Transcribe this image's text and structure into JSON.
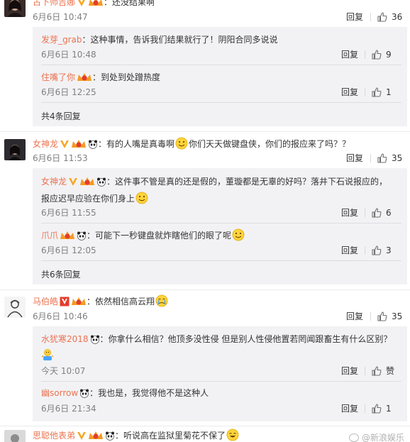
{
  "colors": {
    "username": "#eb7350",
    "subbox_bg": "#f2f2f5",
    "meta": "#808080"
  },
  "comments": [
    {
      "user": "古下师吉娜",
      "sep": "：",
      "text": "还没结果啊",
      "time": "6月6日 10:47",
      "reply_label": "回复",
      "likes": "36",
      "replies": [
        {
          "user": "发芽_grab",
          "sep": "：",
          "text": "这种事情，告诉我们结果就行了！阴阳合同多说说",
          "time": "6月6日 10:48",
          "reply_label": "回复",
          "likes": "9"
        },
        {
          "user": "住嘴了你",
          "sep": "：",
          "text": "到处到处蹭热度",
          "time": "6月6日 12:25",
          "reply_label": "回复",
          "likes": "1"
        }
      ],
      "more_label": "共4条回复"
    },
    {
      "user": "女神龙",
      "sep": "：",
      "text_a": "有的人嘴是真毒啊",
      "text_b": "你们天天做键盘侠，你们的报应来了吗？？",
      "time": "6月6日 11:53",
      "reply_label": "回复",
      "likes": "35",
      "replies": [
        {
          "user": "女神龙",
          "sep": "：",
          "text": "这件事不管是真的还是假的，董璇都是无辜的好吗？落井下石说报应的，",
          "text_line2": "报应迟早应验在你们身上",
          "time": "6月6日 11:55",
          "reply_label": "回复",
          "likes": "6"
        },
        {
          "user": "爪爪",
          "sep": "：",
          "text": "可能下一秒键盘就炸瞎他们的眼了呢",
          "time": "6月6日 12:05",
          "reply_label": "回复",
          "likes": "3"
        }
      ],
      "more_label": "共6条回复"
    },
    {
      "user": "马伯皓",
      "sep": "：",
      "text": "依然相信高云翔",
      "time": "6月6日 10:46",
      "reply_label": "回复",
      "likes": "35",
      "replies": [
        {
          "user": "水犹寒2018",
          "sep": "：",
          "text": "你拿什么相信？他顶多没性侵  但是别人性侵他置若罔闻跟畜生有什么区别？",
          "time": "今天 10:07",
          "reply_label": "回复",
          "likes": "赞"
        },
        {
          "user": "幽sorrow",
          "sep": "：",
          "text": "我也是，我觉得他不是这种人",
          "time": "6月6日 21:34",
          "reply_label": "回复",
          "likes": "1"
        }
      ]
    },
    {
      "user": "思聪他表弟",
      "sep": "：",
      "text": "听说高在监狱里菊花不保了"
    }
  ],
  "watermark": "@新浪娱乐"
}
